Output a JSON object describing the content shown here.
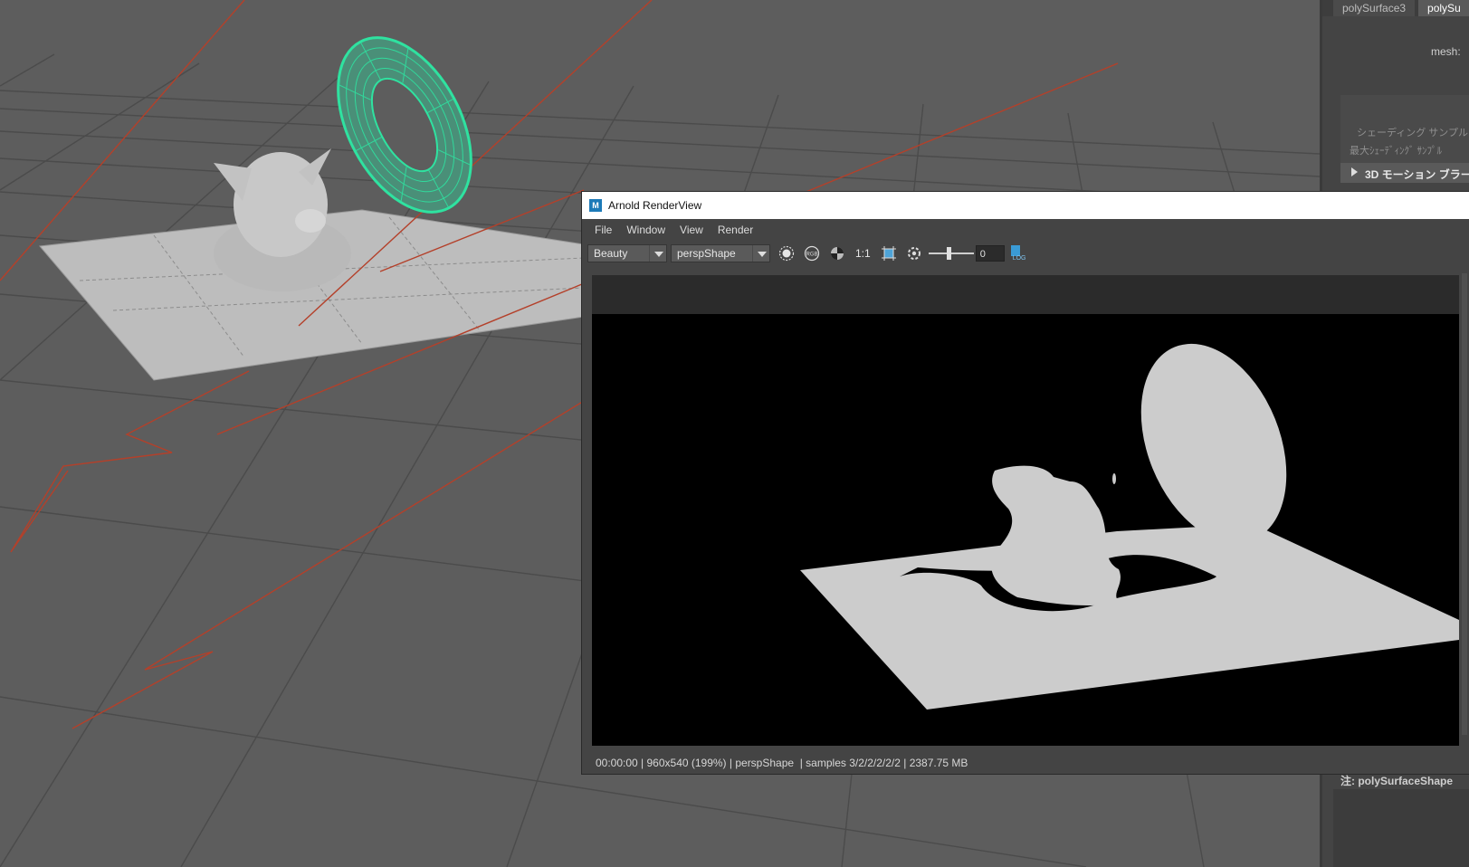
{
  "attribute_editor": {
    "tabs": [
      "polySurface3",
      "polySu"
    ],
    "mesh_label": "mesh:",
    "shading_samples_label": "シェーディング サンプル",
    "max_shading_samples_label": "最大ｼｪｰﾃﾞｨﾝｸﾞ ｻﾝﾌﾟﾙ",
    "section_motion_blur": "3D モーション ブラー",
    "note_label": "注:  polySurfaceShape"
  },
  "render_view": {
    "title": "Arnold RenderView",
    "logo": "M",
    "menus": [
      "File",
      "Window",
      "View",
      "Render"
    ],
    "aov_dropdown": "Beauty",
    "camera_dropdown": "perspShape",
    "rgb_label": "RGB",
    "ratio_label": "1:1",
    "exposure_value": "0",
    "exposure_slider_fraction": 0.45,
    "log_label": "LOG",
    "status": "00:00:00 | 960x540 (199%) | perspShape  | samples 3/2/2/2/2/2 | 2387.75 MB"
  },
  "colors": {
    "viewport_bg": "#5d5d5d",
    "grid_line": "#4a4a4a",
    "plane": "#bdbdbd",
    "torus_wire": "#2fe2a0",
    "curve_red": "#b4402a",
    "render_matte": "#cccccc"
  }
}
